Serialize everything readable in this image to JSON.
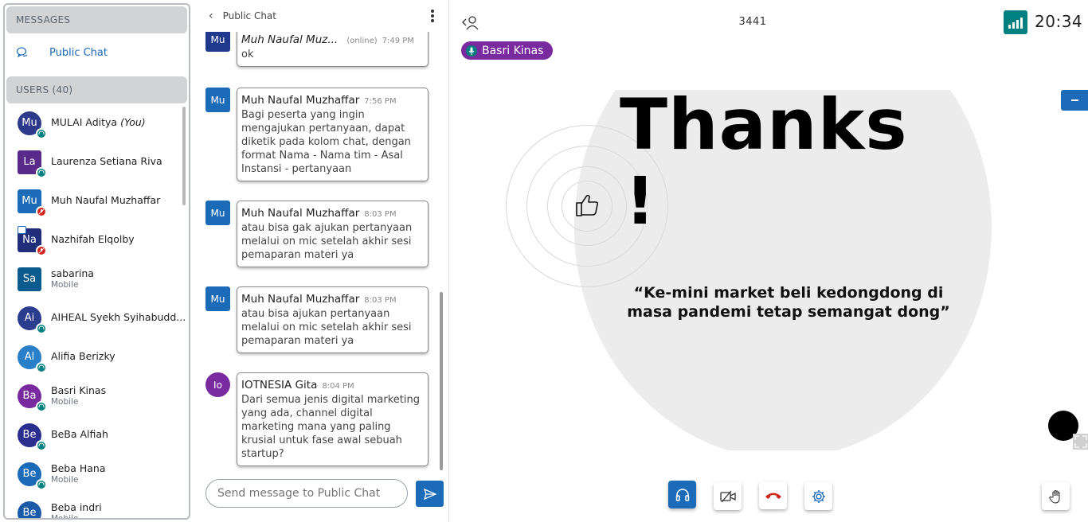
{
  "sidebar": {
    "messages_header": "MESSAGES",
    "public_chat_label": "Public Chat",
    "users_header": "USERS (40)",
    "users": [
      {
        "initials": "Mu",
        "name": "MULAI Aditya",
        "you_tag": "(You)",
        "sub": "",
        "color": "#2d3a8c",
        "shape": "round",
        "badge": "listen"
      },
      {
        "initials": "La",
        "name": "Laurenza Setiana Riva",
        "you_tag": "",
        "sub": "",
        "color": "#5a2a8a",
        "shape": "square",
        "badge": "listen"
      },
      {
        "initials": "Mu",
        "name": "Muh Naufal Muzhaffar",
        "you_tag": "",
        "sub": "",
        "color": "#1b6bb8",
        "shape": "square",
        "badge": "muted"
      },
      {
        "initials": "Na",
        "name": "Nazhifah Elqolby",
        "you_tag": "",
        "sub": "",
        "color": "#1f2d7a",
        "shape": "square",
        "badge": "muted"
      },
      {
        "initials": "Sa",
        "name": "sabarina",
        "you_tag": "",
        "sub": "Mobile",
        "color": "#0b5b8f",
        "shape": "square",
        "badge": ""
      },
      {
        "initials": "Ai",
        "name": "AIHEAL Syekh Syihabudd...",
        "you_tag": "",
        "sub": "",
        "color": "#2a3d8f",
        "shape": "round",
        "badge": "listen"
      },
      {
        "initials": "Al",
        "name": "Alifia Berizky",
        "you_tag": "",
        "sub": "",
        "color": "#2a7fc9",
        "shape": "round",
        "badge": "listen"
      },
      {
        "initials": "Ba",
        "name": "Basri Kinas",
        "you_tag": "",
        "sub": "Mobile",
        "color": "#7a2a9f",
        "shape": "round",
        "badge": "listen"
      },
      {
        "initials": "Be",
        "name": "BeBa Alfiah",
        "you_tag": "",
        "sub": "",
        "color": "#2a2f8f",
        "shape": "round",
        "badge": "listen"
      },
      {
        "initials": "Be",
        "name": "Beba Hana",
        "you_tag": "",
        "sub": "Mobile",
        "color": "#1b6bb8",
        "shape": "round",
        "badge": "listen"
      },
      {
        "initials": "Be",
        "name": "Beba indri",
        "you_tag": "",
        "sub": "Mobile",
        "color": "#1b5aa8",
        "shape": "round",
        "badge": "listen"
      }
    ]
  },
  "chat": {
    "header_title": "Public Chat",
    "messages": [
      {
        "initials": "Mu",
        "name": "Muh Naufal Muz...",
        "status": "(online)",
        "time": "7:49 PM",
        "text": "ok",
        "color": "#1f3a8c",
        "round": false
      },
      {
        "initials": "Mu",
        "name": "Muh Naufal Muzhaffar",
        "status": "",
        "time": "7:56 PM",
        "text": "Bagi peserta yang ingin mengajukan pertanyaan, dapat diketik pada kolom chat, dengan format Nama - Nama tim - Asal Instansi - pertanyaan",
        "color": "#1b6bb8",
        "round": false
      },
      {
        "initials": "Mu",
        "name": "Muh Naufal Muzhaffar",
        "status": "",
        "time": "8:03 PM",
        "text": "atau bisa gak ajukan pertanyaan melalui on mic setelah akhir sesi pemaparan materi ya",
        "color": "#1b6bb8",
        "round": false
      },
      {
        "initials": "Mu",
        "name": "Muh Naufal Muzhaffar",
        "status": "",
        "time": "8:03 PM",
        "text": "atau bisa ajukan pertanyaan melalui on mic setelah akhir sesi pemaparan materi ya",
        "color": "#1b6bb8",
        "round": false
      },
      {
        "initials": "Io",
        "name": "IOTNESIA Gita",
        "status": "",
        "time": "8:04 PM",
        "text": "Dari semua jenis digital marketing yang ada, channel digital marketing mana yang paling krusial untuk fase awal sebuah startup?",
        "color": "#7a2a9f",
        "round": true
      }
    ],
    "input_placeholder": "Send message to Public Chat"
  },
  "main": {
    "meeting_title": "3441",
    "clock": "20:34",
    "talker_name": "Basri Kinas",
    "slide": {
      "title": "Thanks",
      "exclamation": "!",
      "quote": "“Ke-mini market beli kedongdong di masa pandemi tetap semangat dong”"
    }
  },
  "colors": {
    "primary": "#1b6bb8",
    "listen_badge": "#008081",
    "muted_badge": "#d0261d",
    "talker": "#7a2a9f",
    "leave": "#d0261d"
  }
}
